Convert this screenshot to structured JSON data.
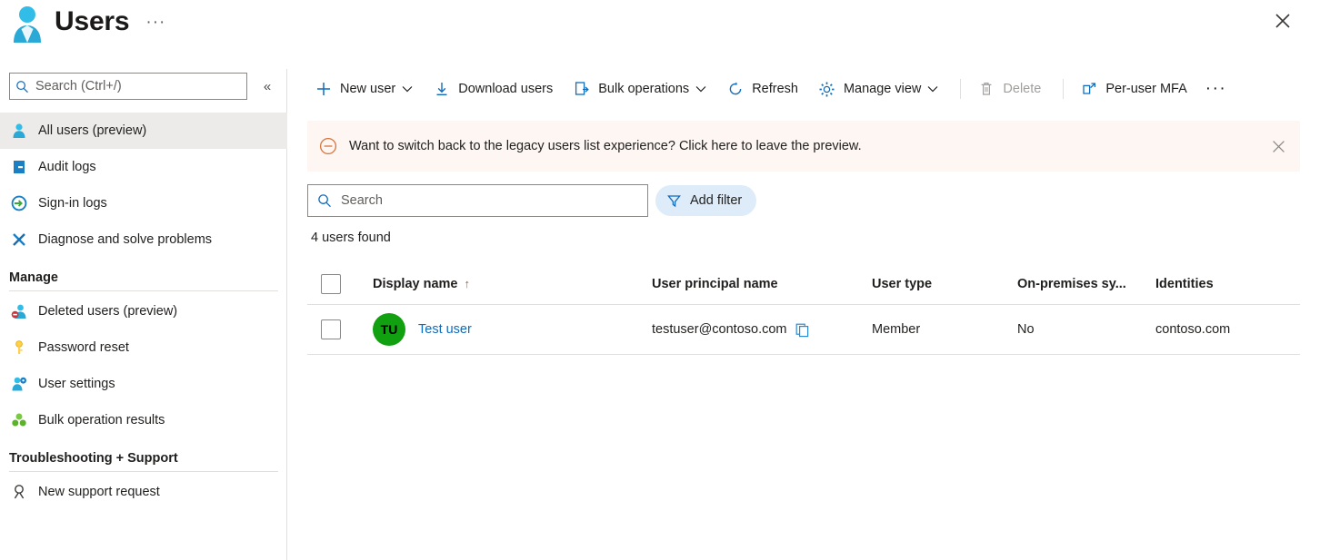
{
  "header": {
    "title": "Users",
    "ellipsis": "···",
    "app_icon": "user-app-icon",
    "close_icon": "close-icon"
  },
  "sidebar": {
    "search": {
      "placeholder": "Search (Ctrl+/)",
      "value": "",
      "icon": "search-icon"
    },
    "collapse_icon": "«",
    "items": [
      {
        "label": "All users (preview)",
        "icon": "user-icon",
        "selected": true
      },
      {
        "label": "Audit logs",
        "icon": "audit-log-icon",
        "selected": false
      },
      {
        "label": "Sign-in logs",
        "icon": "sign-in-icon",
        "selected": false
      },
      {
        "label": "Diagnose and solve problems",
        "icon": "wrench-cross-icon",
        "selected": false
      }
    ],
    "groups": [
      {
        "title": "Manage",
        "items": [
          {
            "label": "Deleted users (preview)",
            "icon": "deleted-user-icon"
          },
          {
            "label": "Password reset",
            "icon": "key-icon"
          },
          {
            "label": "User settings",
            "icon": "user-settings-icon"
          },
          {
            "label": "Bulk operation results",
            "icon": "bulk-results-icon"
          }
        ]
      },
      {
        "title": "Troubleshooting + Support",
        "items": [
          {
            "label": "New support request",
            "icon": "support-person-icon"
          }
        ]
      }
    ]
  },
  "toolbar": {
    "items": [
      {
        "label": "New user",
        "icon": "plus-icon",
        "caret": true,
        "disabled": false
      },
      {
        "label": "Download users",
        "icon": "download-icon",
        "caret": false,
        "disabled": false
      },
      {
        "label": "Bulk operations",
        "icon": "bulk-operations-icon",
        "caret": true,
        "disabled": false
      },
      {
        "label": "Refresh",
        "icon": "refresh-icon",
        "caret": false,
        "disabled": false
      },
      {
        "label": "Manage view",
        "icon": "gear-icon",
        "caret": true,
        "disabled": false
      },
      {
        "label": "Delete",
        "icon": "trash-icon",
        "caret": false,
        "disabled": true
      },
      {
        "label": "Per-user MFA",
        "icon": "external-link-icon",
        "caret": false,
        "disabled": false
      }
    ],
    "more_label": "···"
  },
  "banner": {
    "icon": "minus-circle-icon",
    "text": "Want to switch back to the legacy users list experience? Click here to leave the preview.",
    "close_icon": "close-icon",
    "background": "#fdf6f3"
  },
  "filters": {
    "search": {
      "placeholder": "Search",
      "value": "",
      "icon": "search-icon"
    },
    "add_filter_label": "Add filter",
    "add_filter_icon": "funnel-icon"
  },
  "results": {
    "count_text": "4 users found"
  },
  "table": {
    "columns": [
      {
        "key": "display_name",
        "label": "Display name",
        "sort": "↑"
      },
      {
        "key": "upn",
        "label": "User principal name",
        "sort": ""
      },
      {
        "key": "user_type",
        "label": "User type",
        "sort": ""
      },
      {
        "key": "on_premises",
        "label": "On-premises sy...",
        "sort": ""
      },
      {
        "key": "identities",
        "label": "Identities",
        "sort": ""
      }
    ],
    "rows": [
      {
        "selected": false,
        "avatar_initials": "TU",
        "avatar_color": "#10a010",
        "display_name": "Test user",
        "upn": "testuser@contoso.com",
        "copy_icon": "copy-icon",
        "user_type": "Member",
        "on_premises": "No",
        "identities": "contoso.com"
      }
    ]
  },
  "colors": {
    "accent": "#0f6cbd",
    "selected_nav": "#edebe9",
    "banner_bg": "#fdf6f3",
    "banner_icon": "#d8743a",
    "filter_chip": "#deecf9"
  }
}
